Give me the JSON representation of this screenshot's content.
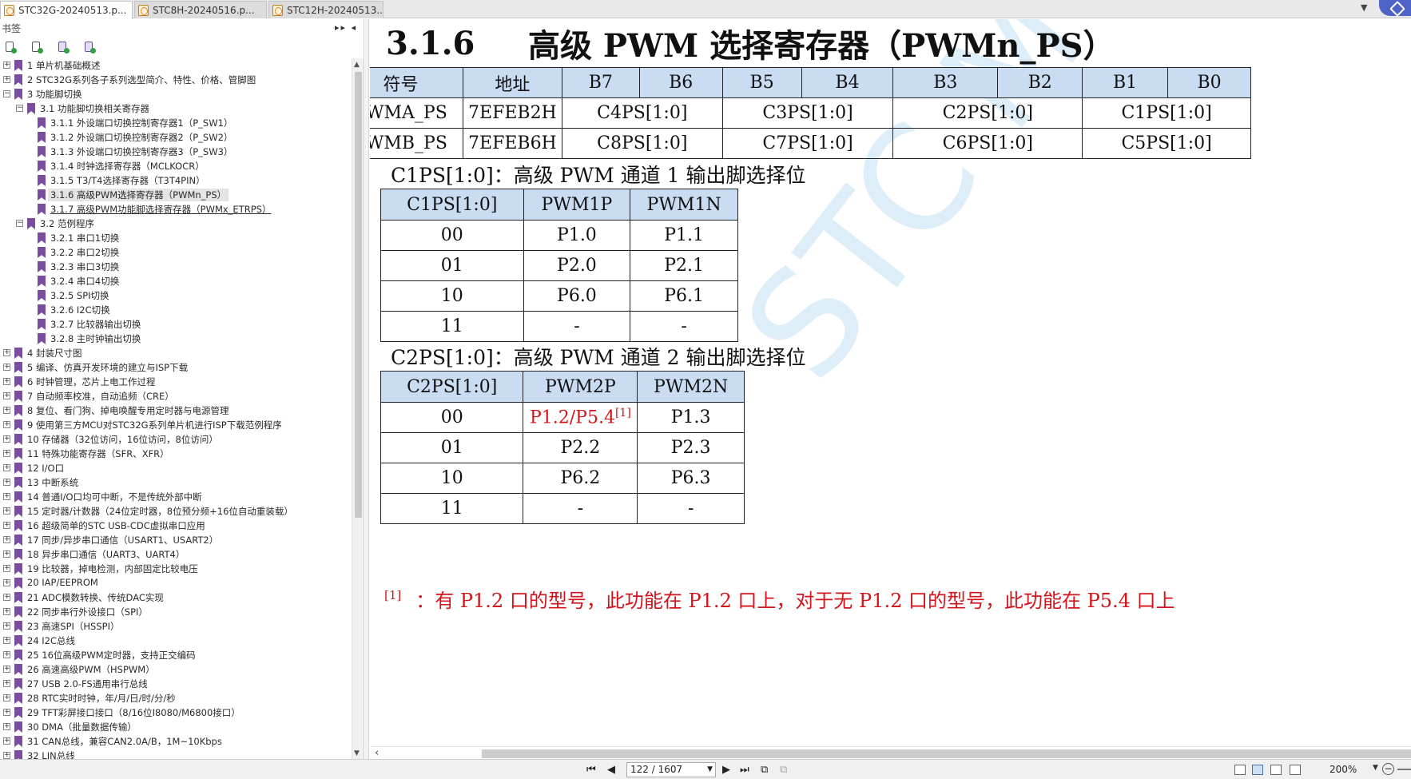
{
  "tabs": [
    {
      "label": "STC32G-20240513.p...",
      "active": true,
      "close": "×"
    },
    {
      "label": "STC8H-20240516.p...",
      "active": false
    },
    {
      "label": "STC12H-20240513....",
      "active": false
    }
  ],
  "tab_menu_glyph": "▼",
  "sidebar": {
    "title": "书签",
    "header_controls": "▸▸ ◂",
    "toolbar_icons": [
      "bookmark-expand-icon",
      "bookmark-collapse-icon",
      "bookmark-add-icon",
      "bookmark-find-icon"
    ],
    "tree": [
      {
        "level": 0,
        "expander": "+",
        "label": "1 单片机基础概述"
      },
      {
        "level": 0,
        "expander": "+",
        "label": "2  STC32G系列各子系列选型简介、特性、价格、管脚图"
      },
      {
        "level": 0,
        "expander": "-",
        "label": "3  功能脚切换"
      },
      {
        "level": 1,
        "expander": "-",
        "label": "3.1 功能脚切换相关寄存器"
      },
      {
        "level": 2,
        "expander": "",
        "label": "3.1.1  外设端口切换控制寄存器1（P_SW1）"
      },
      {
        "level": 2,
        "expander": "",
        "label": "3.1.2  外设端口切换控制寄存器2（P_SW2）"
      },
      {
        "level": 2,
        "expander": "",
        "label": "3.1.3  外设端口切换控制寄存器3（P_SW3）"
      },
      {
        "level": 2,
        "expander": "",
        "label": "3.1.4  时钟选择寄存器（MCLKOCR）"
      },
      {
        "level": 2,
        "expander": "",
        "label": "3.1.5  T3/T4选择寄存器（T3T4PIN）"
      },
      {
        "level": 2,
        "expander": "",
        "label": "3.1.6  高级PWM选择寄存器（PWMn_PS）",
        "selected": true
      },
      {
        "level": 2,
        "expander": "",
        "label": "3.1.7  高级PWM功能脚选择寄存器（PWMx_ETRPS）",
        "link": true
      },
      {
        "level": 1,
        "expander": "-",
        "label": "3.2  范例程序"
      },
      {
        "level": 2,
        "expander": "",
        "label": "3.2.1 串口1切换"
      },
      {
        "level": 2,
        "expander": "",
        "label": "3.2.2 串口2切换"
      },
      {
        "level": 2,
        "expander": "",
        "label": "3.2.3 串口3切换"
      },
      {
        "level": 2,
        "expander": "",
        "label": "3.2.4 串口4切换"
      },
      {
        "level": 2,
        "expander": "",
        "label": "3.2.5 SPI切换"
      },
      {
        "level": 2,
        "expander": "",
        "label": "3.2.6 I2C切换"
      },
      {
        "level": 2,
        "expander": "",
        "label": "3.2.7 比较器输出切换"
      },
      {
        "level": 2,
        "expander": "",
        "label": "3.2.8 主时钟输出切换"
      },
      {
        "level": 0,
        "expander": "+",
        "label": "4  封装尺寸图"
      },
      {
        "level": 0,
        "expander": "+",
        "label": "5  编译、仿真开发环境的建立与ISP下载"
      },
      {
        "level": 0,
        "expander": "+",
        "label": "6  时钟管理，芯片上电工作过程"
      },
      {
        "level": 0,
        "expander": "+",
        "label": "7  自动频率校准，自动追频（CRE）"
      },
      {
        "level": 0,
        "expander": "+",
        "label": "8  复位、看门狗、掉电唤醒专用定时器与电源管理"
      },
      {
        "level": 0,
        "expander": "+",
        "label": "9  使用第三方MCU对STC32G系列单片机进行ISP下载范例程序"
      },
      {
        "level": 0,
        "expander": "+",
        "label": "10  存储器（32位访问，16位访问，8位访问）"
      },
      {
        "level": 0,
        "expander": "+",
        "label": "11  特殊功能寄存器（SFR、XFR）"
      },
      {
        "level": 0,
        "expander": "+",
        "label": "12  I/O口"
      },
      {
        "level": 0,
        "expander": "+",
        "label": "13  中断系统"
      },
      {
        "level": 0,
        "expander": "+",
        "label": "14  普通I/O口均可中断，不是传统外部中断"
      },
      {
        "level": 0,
        "expander": "+",
        "label": "15  定时器/计数器（24位定时器，8位预分频+16位自动重装载）"
      },
      {
        "level": 0,
        "expander": "+",
        "label": "16  超级简单的STC USB-CDC虚拟串口应用"
      },
      {
        "level": 0,
        "expander": "+",
        "label": "17  同步/异步串口通信（USART1、USART2）"
      },
      {
        "level": 0,
        "expander": "+",
        "label": "18  异步串口通信（UART3、UART4）"
      },
      {
        "level": 0,
        "expander": "+",
        "label": "19  比较器，掉电检测，内部固定比较电压"
      },
      {
        "level": 0,
        "expander": "+",
        "label": "20  IAP/EEPROM"
      },
      {
        "level": 0,
        "expander": "+",
        "label": "21  ADC模数转换、传统DAC实现"
      },
      {
        "level": 0,
        "expander": "+",
        "label": "22  同步串行外设接口（SPI）"
      },
      {
        "level": 0,
        "expander": "+",
        "label": "23  高速SPI（HSSPI）"
      },
      {
        "level": 0,
        "expander": "+",
        "label": "24  I2C总线"
      },
      {
        "level": 0,
        "expander": "+",
        "label": "25  16位高级PWM定时器，支持正交编码"
      },
      {
        "level": 0,
        "expander": "+",
        "label": "26  高速高级PWM（HSPWM）"
      },
      {
        "level": 0,
        "expander": "+",
        "label": "27  USB 2.0-FS通用串行总线"
      },
      {
        "level": 0,
        "expander": "+",
        "label": "28  RTC实时时钟，年/月/日/时/分/秒"
      },
      {
        "level": 0,
        "expander": "+",
        "label": "29  TFT彩屏接口接口（8/16位I8080/M6800接口）"
      },
      {
        "level": 0,
        "expander": "+",
        "label": "30  DMA（批量数据传输）"
      },
      {
        "level": 0,
        "expander": "+",
        "label": "31  CAN总线，兼容CAN2.0A/B，1M~10Kbps"
      },
      {
        "level": 0,
        "expander": "+",
        "label": "32  LIN总线"
      }
    ]
  },
  "document": {
    "section_number": "3.1.6",
    "section_title": "高级 PWM 选择寄存器（PWMn_PS）",
    "watermark": "STC MCU",
    "register_table": {
      "headers": [
        "符号",
        "地址",
        "B7",
        "B6",
        "B5",
        "B4",
        "B3",
        "B2",
        "B1",
        "B0"
      ],
      "rows": [
        {
          "symbol": "PWMA_PS",
          "address": "7EFEB2H",
          "fields": [
            "C4PS[1:0]",
            "C3PS[1:0]",
            "C2PS[1:0]",
            "C1PS[1:0]"
          ]
        },
        {
          "symbol": "PWMB_PS",
          "address": "7EFEB6H",
          "fields": [
            "C8PS[1:0]",
            "C7PS[1:0]",
            "C6PS[1:0]",
            "C5PS[1:0]"
          ]
        }
      ]
    },
    "c1ps_label": "C1PS[1:0]：高级 PWM 通道 1 输出脚选择位",
    "c1ps_table": {
      "headers": [
        "C1PS[1:0]",
        "PWM1P",
        "PWM1N"
      ],
      "rows": [
        [
          "00",
          "P1.0",
          "P1.1"
        ],
        [
          "01",
          "P2.0",
          "P2.1"
        ],
        [
          "10",
          "P6.0",
          "P6.1"
        ],
        [
          "11",
          "-",
          "-"
        ]
      ]
    },
    "c2ps_label": "C2PS[1:0]：高级 PWM 通道 2 输出脚选择位",
    "c2ps_table": {
      "headers": [
        "C2PS[1:0]",
        "PWM2P",
        "PWM2N"
      ],
      "row0_value": "00",
      "row0_p": "P1.2/P5.4",
      "row0_p_sup": "[1]",
      "row0_n": "P1.3",
      "rows": [
        [
          "01",
          "P2.2",
          "P2.3"
        ],
        [
          "10",
          "P6.2",
          "P6.3"
        ],
        [
          "11",
          "-",
          "-"
        ]
      ]
    },
    "footnote_marker": "[1]",
    "footnote_text": "：有 P1.2 口的型号，此功能在 P1.2 口上，对于无 P1.2 口的型号，此功能在 P5.4 口上",
    "accent_red": "#d4141a",
    "header_fill": "#c9dcf2"
  },
  "statusbar": {
    "page_indicator": "122 / 1607",
    "zoom": "200%"
  }
}
